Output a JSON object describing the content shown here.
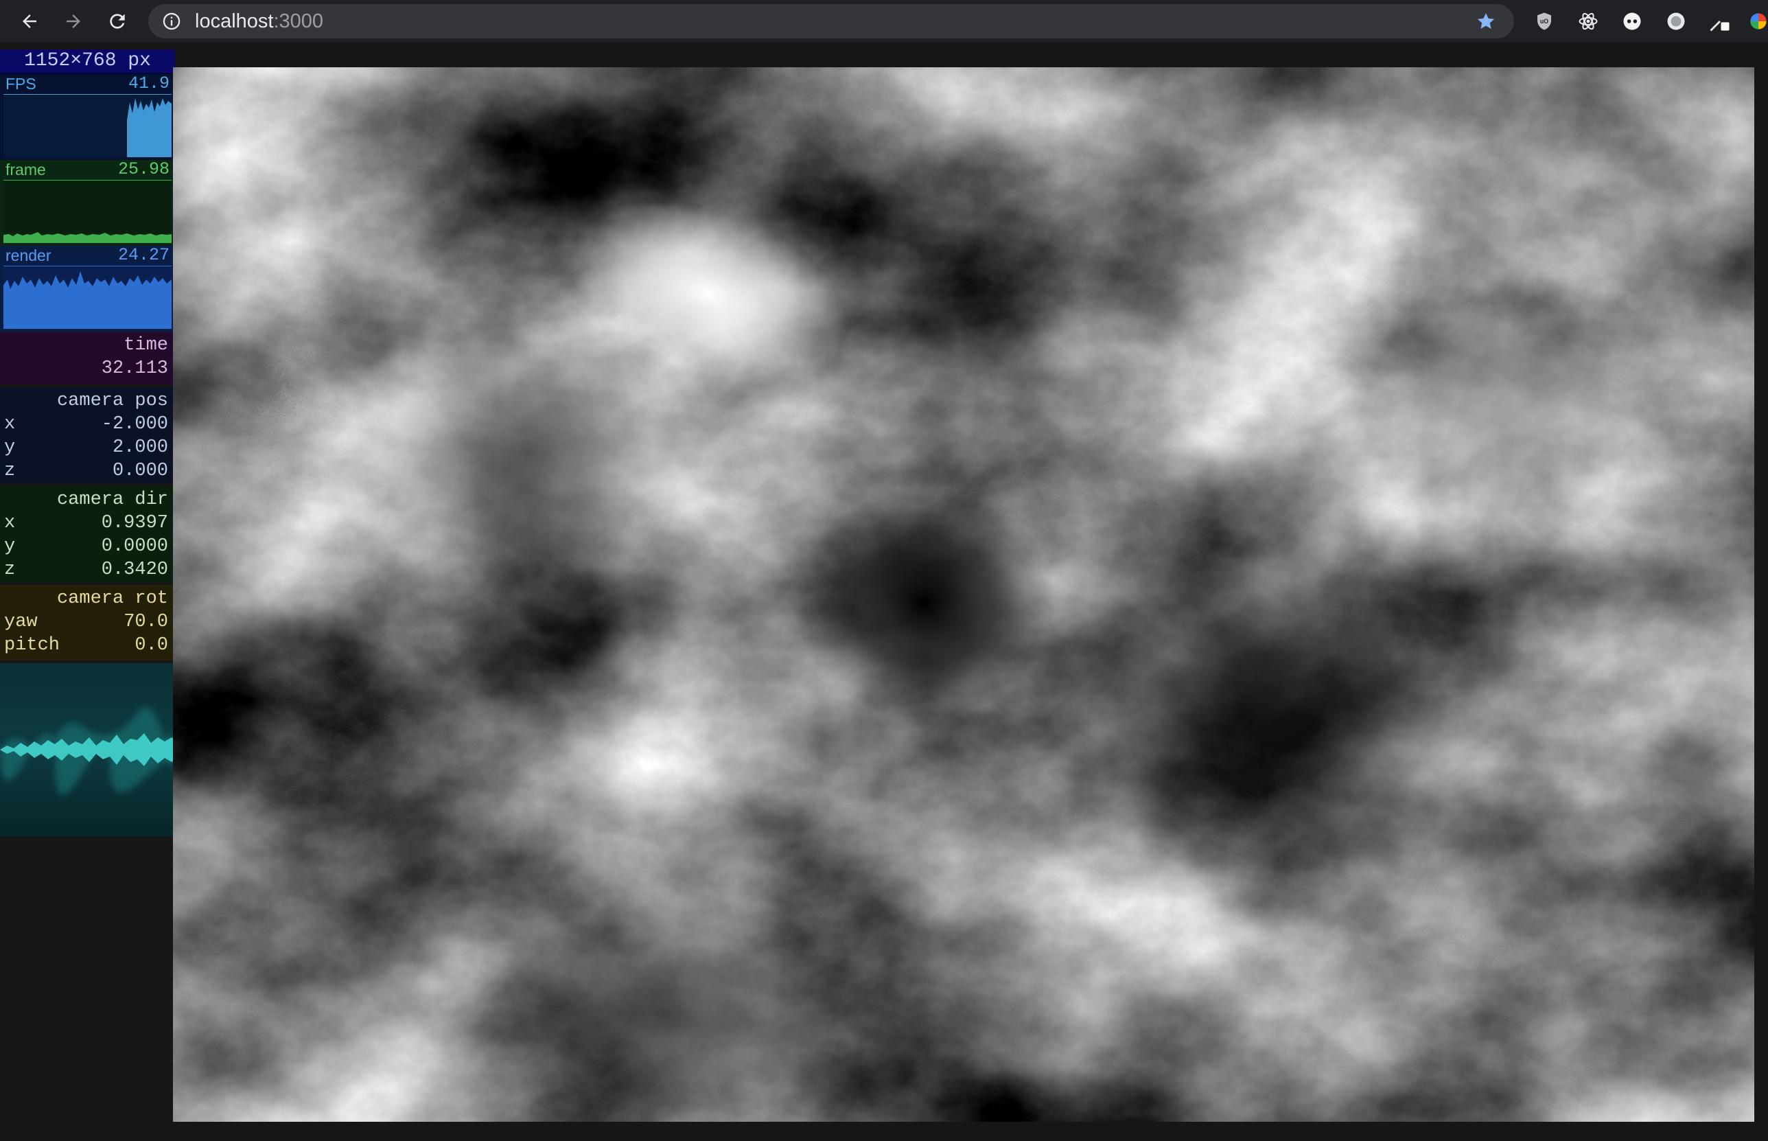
{
  "browser": {
    "url_host": "localhost",
    "url_port": ":3000",
    "icons": [
      "back-arrow-icon",
      "forward-arrow-icon",
      "reload-icon",
      "site-info-icon",
      "bookmark-star-icon",
      "ublock-icon",
      "react-devtools-icon",
      "extension-circle-icon",
      "extension-record-icon",
      "eyedropper-icon",
      "color-wheel-icon"
    ]
  },
  "stats": {
    "resolution": "1152×768 px",
    "fps": {
      "label": "FPS",
      "value": "41.9",
      "color": "#3f97d4"
    },
    "frame": {
      "label": "frame",
      "value": "25.98",
      "color": "#3fae4c"
    },
    "render": {
      "label": "render",
      "value": "24.27",
      "color": "#2d6fd0"
    },
    "time": {
      "title": "time",
      "value": "32.113"
    },
    "camera_pos": {
      "title": "camera pos",
      "x": "-2.000",
      "y": "2.000",
      "z": "0.000"
    },
    "camera_dir": {
      "title": "camera dir",
      "x": "0.9397",
      "y": "0.0000",
      "z": "0.3420"
    },
    "camera_rot": {
      "title": "camera rot",
      "yaw": "70.0",
      "pitch": "0.0"
    },
    "axis_labels": {
      "x": "x",
      "y": "y",
      "z": "z",
      "yaw": "yaw",
      "pitch": "pitch"
    }
  },
  "colors": {
    "chrome_bg": "#202124",
    "omnibox_bg": "#35363a",
    "bookmark_star": "#8ab4f8",
    "wave": "#3ec9c4"
  }
}
